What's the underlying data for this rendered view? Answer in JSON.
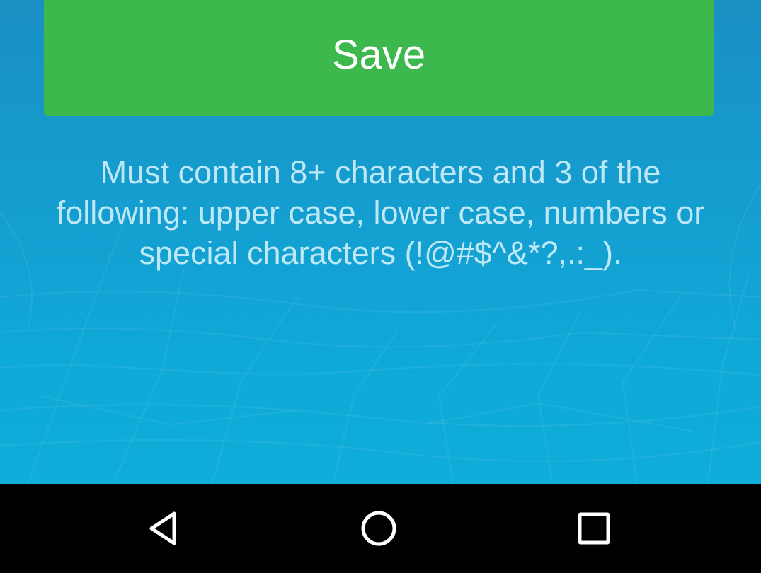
{
  "actions": {
    "save_label": "Save"
  },
  "hint": {
    "text": "Must contain 8+ characters and 3 of the following: upper case, lower case, numbers or special characters (!@#$^&*?,.:_)."
  },
  "navbar": {
    "back_icon": "back-triangle-icon",
    "home_icon": "home-circle-icon",
    "recents_icon": "recents-square-icon"
  },
  "colors": {
    "button_green": "#3cb84c",
    "background_blue": "#159dcf",
    "hint_text": "#bfe8f7",
    "navbar": "#000000"
  }
}
